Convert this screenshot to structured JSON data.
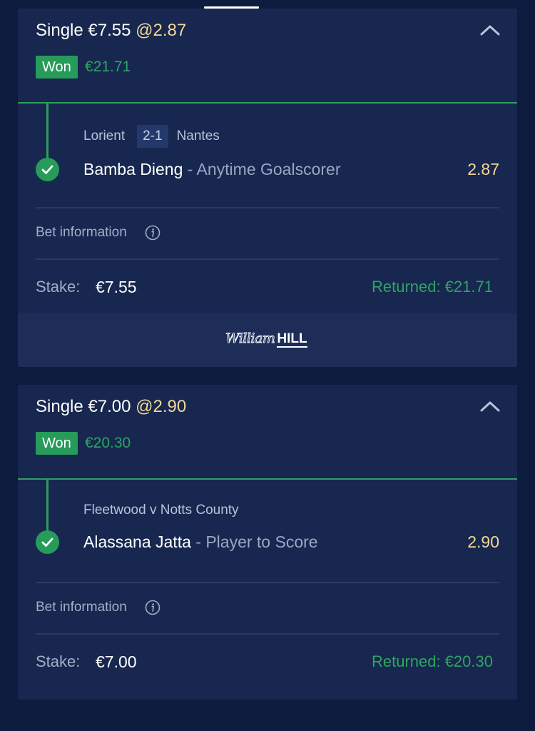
{
  "bets": [
    {
      "type_label": "Single",
      "stake_title": "€7.55",
      "odds_title": "@2.87",
      "status": "Won",
      "return_amount": "€21.71",
      "event": {
        "home": "Lorient",
        "score": "2-1",
        "away": "Nantes"
      },
      "selection": {
        "player": "Bamba Dieng",
        "separator": " - ",
        "market": "Anytime Goalscorer",
        "odds": "2.87"
      },
      "bet_info_label": "Bet information",
      "stake_label": "Stake:",
      "stake_value": "€7.55",
      "returned_label": "Returned: €21.71"
    },
    {
      "type_label": "Single",
      "stake_title": "€7.00",
      "odds_title": "@2.90",
      "status": "Won",
      "return_amount": "€20.30",
      "event": {
        "title": "Fleetwood v Notts County"
      },
      "selection": {
        "player": "Alassana Jatta",
        "separator": " - ",
        "market": "Player to Score",
        "odds": "2.90"
      },
      "bet_info_label": "Bet information",
      "stake_label": "Stake:",
      "stake_value": "€7.00",
      "returned_label": "Returned: €20.30"
    }
  ],
  "brand": {
    "script_part": "William",
    "bold_part": "HILL"
  },
  "colors": {
    "background": "#0d1b3e",
    "card": "#17274f",
    "accent_green": "#269b5a",
    "odds_gold": "#f2d79a"
  },
  "icons": {
    "collapse": "chevron-up-icon",
    "check": "checkmark-icon",
    "info": "info-icon"
  }
}
